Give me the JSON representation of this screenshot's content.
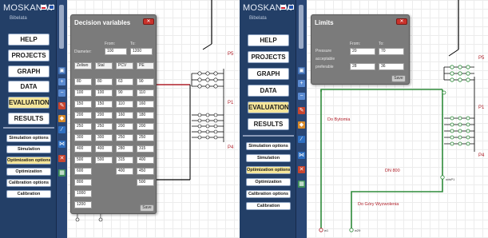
{
  "app": {
    "title": "MOSKAN-W",
    "subtitle": "Bibelata"
  },
  "left_panel": {
    "menu": [
      "HELP",
      "PROJECTS",
      "GRAPH",
      "DATA",
      "EVALUATION",
      "RESULTS"
    ],
    "active_menu": "EVALUATION",
    "options": [
      "Simulation options",
      "Simulation",
      "Optimization options",
      "Optimization",
      "Calibration options",
      "Calibration"
    ],
    "active_option": "Optimization options",
    "dialog": {
      "title": "Decision variables",
      "close": "✕",
      "col_from": "From:",
      "col_to": "To:",
      "diameter_label": "Diameter:",
      "diameter_from": "100",
      "diameter_to": "1200",
      "materials": [
        "Żeliwo",
        "Stal",
        "PCV",
        "PE"
      ],
      "rows": [
        [
          "80",
          "80",
          "63",
          "90"
        ],
        [
          "100",
          "100",
          "90",
          "110"
        ],
        [
          "150",
          "150",
          "110",
          "160"
        ],
        [
          "200",
          "200",
          "160",
          "180"
        ],
        [
          "250",
          "250",
          "200",
          "200"
        ],
        [
          "300",
          "300",
          "250",
          "250"
        ],
        [
          "400",
          "400",
          "280",
          "315"
        ],
        [
          "500",
          "500",
          "315",
          "400"
        ],
        [
          "600",
          "",
          "400",
          "450"
        ],
        [
          "800",
          "",
          "",
          "500"
        ],
        [
          "1000",
          "",
          "",
          ""
        ],
        [
          "1200",
          "",
          "",
          ""
        ]
      ],
      "save": "Save"
    },
    "network_labels": {
      "p5": "P5",
      "p1": "P1",
      "p4": "P4"
    }
  },
  "right_panel": {
    "menu": [
      "HELP",
      "PROJECTS",
      "GRAPH",
      "DATA",
      "EVALUATION",
      "RESULTS"
    ],
    "active_menu": "EVALUATION",
    "options": [
      "Simulation options",
      "Simulation",
      "Optimization options",
      "Optimization",
      "Calibration options",
      "Calibration"
    ],
    "active_option": "Optimization options",
    "dialog": {
      "title": "Limits",
      "close": "✕",
      "col_from": "From:",
      "col_to": "To:",
      "pressure_label": "Pressure",
      "acceptable_label": "acceptable",
      "acceptable_from": "20",
      "acceptable_to": "70",
      "preferable_label": "preferable",
      "preferable_from": "28",
      "preferable_to": "36",
      "save": "Save"
    },
    "network_labels": {
      "p5": "P5",
      "p1": "P1",
      "p4": "P4",
      "do_bytomia": "Do Bytomia",
      "dn800": "DN 800",
      "do_gory": "Do Góry Wyzwolenia",
      "node_start": "odsP1",
      "node_a": "w1",
      "node_b": "w29"
    }
  },
  "colors": {
    "sidebar": "#233f67",
    "active": "#f6e69a",
    "pipe_red": "#b0202a",
    "pipe_green": "#2e8b3a",
    "dialog": "#7b7b7b"
  }
}
